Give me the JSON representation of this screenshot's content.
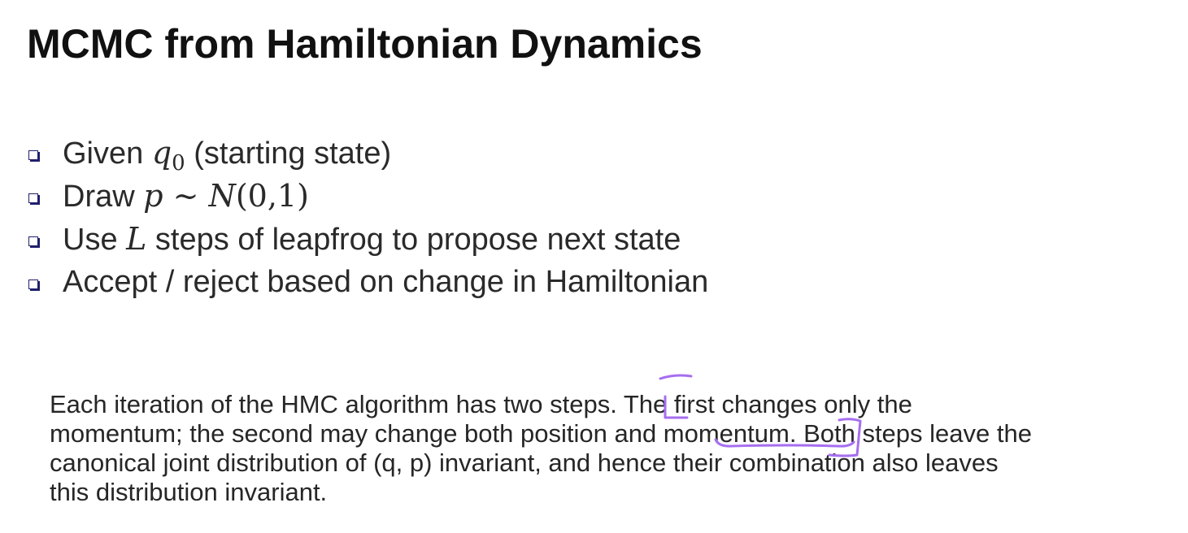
{
  "title": "MCMC from Hamiltonian Dynamics",
  "bullets": [
    {
      "prefix": "Given ",
      "math_var": "q",
      "math_sub": "0",
      "suffix": " (starting state)"
    },
    {
      "prefix": "Draw ",
      "math_var": "p",
      "math_rel": " ∼ ",
      "math_dist": "N",
      "math_args": "(0,1)"
    },
    {
      "prefix": "Use ",
      "math_var": "L",
      "suffix": " steps of leapfrog to propose next state"
    },
    {
      "text": "Accept / reject based on change in Hamiltonian"
    }
  ],
  "paragraph": {
    "line1": "Each iteration of the HMC algorithm has two steps. The first changes only the",
    "line2": "momentum; the second may change both position and momentum. Both steps leave the",
    "line3": "canonical joint distribution of (q, p) invariant, and hence their combination also leaves",
    "line4": "this distribution invariant."
  },
  "colors": {
    "annotation": "#a66ef0",
    "bullet_marker": "#1f1f6e"
  }
}
